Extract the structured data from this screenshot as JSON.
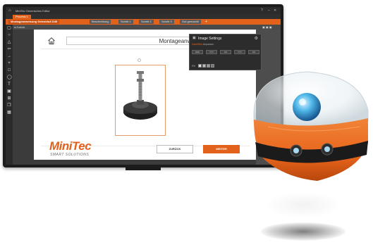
{
  "window": {
    "title": "MiniTec Generisches Editor"
  },
  "process_tab": "Process 1",
  "tabs": [
    {
      "label": "Montageanweisung Gelenkfuß D45"
    },
    {
      "label": "Beschreibung"
    },
    {
      "label": "Schritt 1"
    },
    {
      "label": "Schritt 2"
    },
    {
      "label": "Schritt 3"
    },
    {
      "label": "Gut gemacht!"
    }
  ],
  "toolbar_back": "Zurück",
  "tools": [
    "select-icon",
    "circle-icon",
    "triangle-icon",
    "arrow-left-icon",
    "arrow-right-icon",
    "plus-icon",
    "square-icon",
    "ellipse-icon",
    "text-icon",
    "image-icon",
    "grid-icon",
    "layers-icon",
    "apps-icon"
  ],
  "slide": {
    "title": "Montageanweisung Gelenkfuß D45",
    "logo_name": "MiniTec",
    "logo_subtitle": "SMART SOLUTIONS",
    "back_button": "ZURÜCK",
    "next_button": "WEITER"
  },
  "image_settings": {
    "title": "Image Settings",
    "subtitle_accent": "Datei/Bild",
    "subtitle_rest": "Anpassen",
    "fields": [
      "XXX",
      "YYY",
      "XX",
      "YYY",
      "XX"
    ],
    "fill_label": "Fill"
  },
  "colors": {
    "accent": "#e2621b",
    "robot_orange": "#e8651c",
    "robot_eye": "#4fb6e8"
  }
}
